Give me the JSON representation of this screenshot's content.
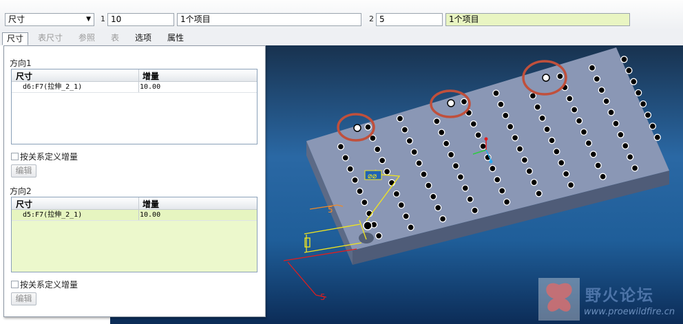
{
  "dashboard": {
    "type_select": "尺寸",
    "dir1": {
      "index": "1",
      "count": "10",
      "items": "1个项目"
    },
    "dir2": {
      "index": "2",
      "count": "5",
      "items": "1个项目"
    }
  },
  "tabs": [
    {
      "label": "尺寸",
      "state": "active"
    },
    {
      "label": "表尺寸",
      "state": "disabled"
    },
    {
      "label": "参照",
      "state": "disabled"
    },
    {
      "label": "表",
      "state": "disabled"
    },
    {
      "label": "选项",
      "state": "normal"
    },
    {
      "label": "属性",
      "state": "normal"
    }
  ],
  "panel": {
    "direction1": {
      "title": "方向1",
      "headers": [
        "尺寸",
        "增量"
      ],
      "rows": [
        {
          "dim": "d6:F7(拉伸_2_1)",
          "inc": "10.00"
        }
      ],
      "checkbox_label": "按关系定义增量",
      "edit_label": "编辑"
    },
    "direction2": {
      "title": "方向2",
      "headers": [
        "尺寸",
        "增量"
      ],
      "rows": [
        {
          "dim": "d5:F7(拉伸_2_1)",
          "inc": "10.00"
        }
      ],
      "checkbox_label": "按关系定义增量",
      "edit_label": "编辑"
    }
  },
  "viewport": {
    "dim_label_top": "5",
    "dim_label_bottom": "5",
    "colors": {
      "plate_top": "#8a97b5",
      "plate_side": "#5c6a86",
      "highlight_ring": "#c0503c",
      "dim_yellow": "#f2e61e",
      "dim_red": "#e21d1d",
      "dim_orange": "#f08a28"
    }
  },
  "watermark": {
    "text": "野火论坛",
    "url": "www.proewildfire.cn"
  },
  "icons": {
    "dropdown": "chevron-down-icon",
    "csys": "coordinate-system-icon",
    "diameter": "diameter-symbol-icon",
    "logo": "butterfly-logo-icon"
  }
}
